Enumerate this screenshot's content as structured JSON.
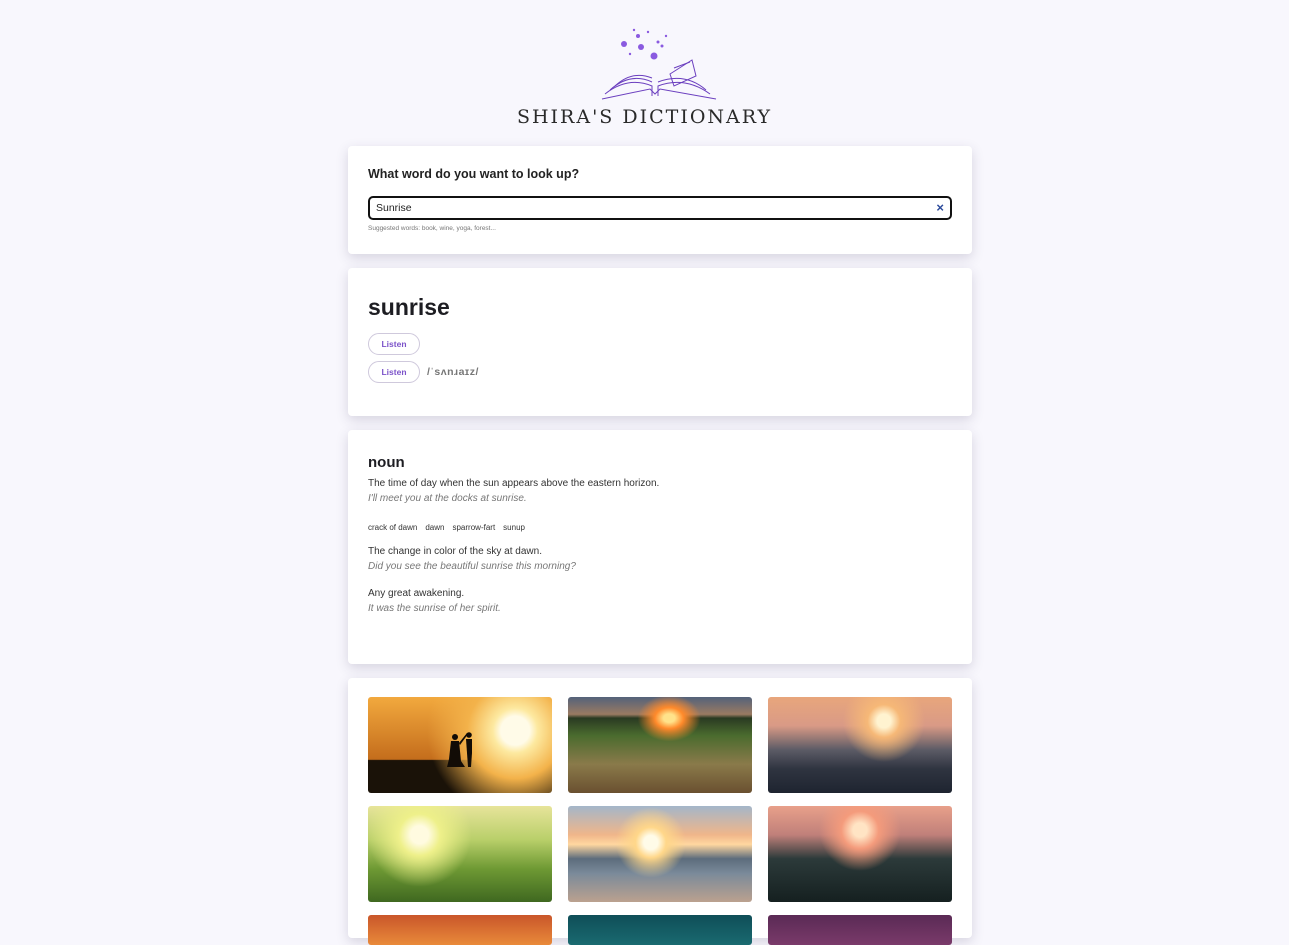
{
  "app": {
    "brand": "SHIRA'S DICTIONARY"
  },
  "search": {
    "question": "What word do you want to look up?",
    "value": "Sunrise",
    "clear_icon": "×",
    "hint": "Suggested words: book, wine, yoga, forest..."
  },
  "word": {
    "title": "sunrise",
    "listen_label": "Listen",
    "phonetic": "/ˈsʌnɹaɪz/"
  },
  "definitions": {
    "part_of_speech": "noun",
    "items": [
      {
        "definition": "The time of day when the sun appears above the eastern horizon.",
        "example": "I'll meet you at the docks at sunrise."
      },
      {
        "definition": "The change in color of the sky at dawn.",
        "example": "Did you see the beautiful sunrise this morning?"
      },
      {
        "definition": "Any great awakening.",
        "example": "It was the sunrise of her spirit."
      }
    ],
    "synonyms": [
      "crack of dawn",
      "dawn",
      "sparrow-fart",
      "sunup"
    ]
  },
  "gallery": {
    "images": [
      {
        "name": "sunrise-photo-couple-silhouette"
      },
      {
        "name": "sunrise-photo-field"
      },
      {
        "name": "sunrise-photo-ocean-waves"
      },
      {
        "name": "sunrise-photo-wheat"
      },
      {
        "name": "sunrise-photo-beach"
      },
      {
        "name": "sunrise-photo-grass-dusk"
      },
      {
        "name": "sunrise-photo-orange-sky"
      },
      {
        "name": "sunrise-photo-teal"
      },
      {
        "name": "sunrise-photo-purple"
      }
    ]
  },
  "colors": {
    "accent": "#7b52c9",
    "background": "#f8f7fd",
    "clear_icon": "#2b4a9b"
  }
}
